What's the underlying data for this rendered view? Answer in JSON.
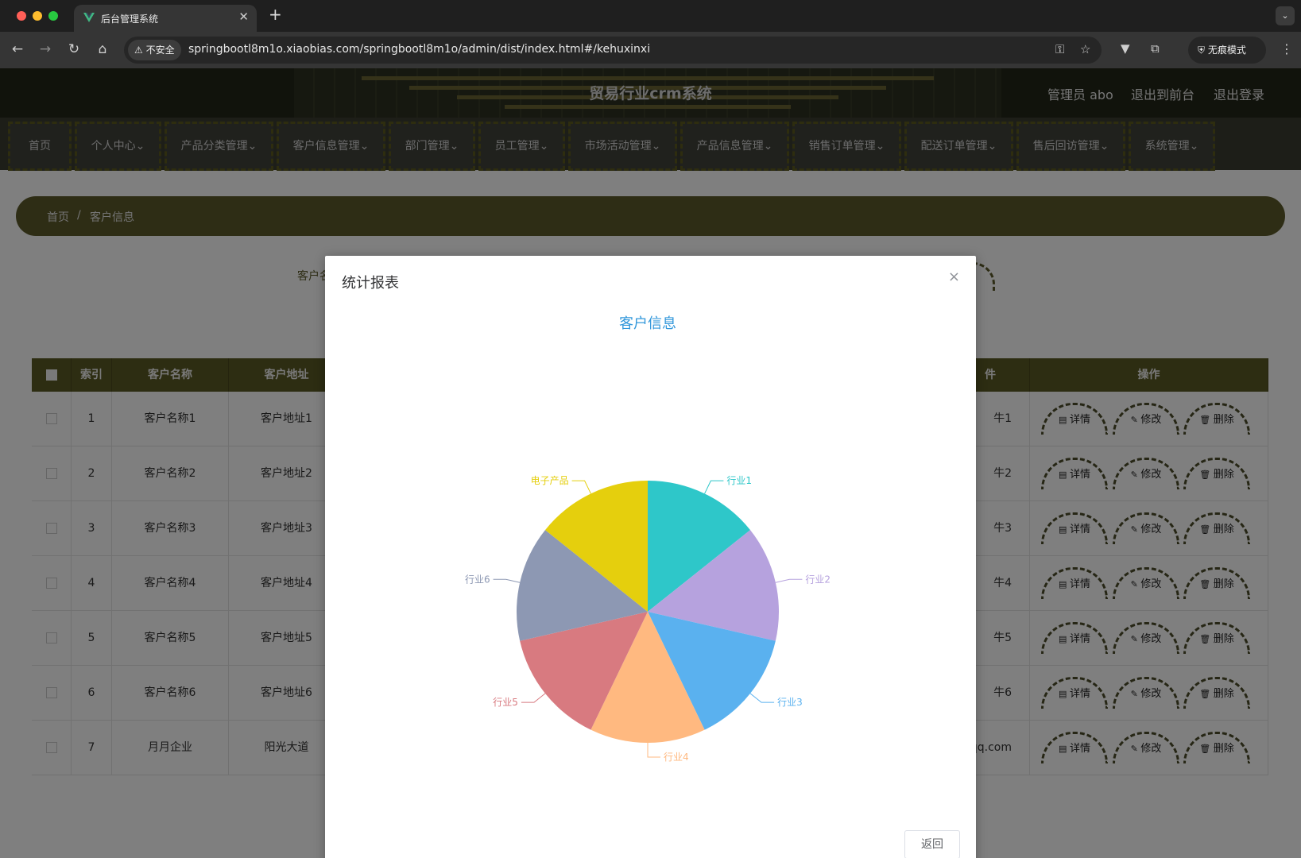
{
  "browser": {
    "tab_title": "后台管理系统",
    "tab_close": "✕",
    "new_tab": "+",
    "tab_menu": "⌄",
    "security_chip": "不安全",
    "url": "springbootl8m1o.xiaobias.com/springbootl8m1o/admin/dist/index.html#/kehuxinxi",
    "incognito_label": "无痕模式",
    "colors": {
      "tab_active": "#353535",
      "titlebar": "#1f1f1f"
    }
  },
  "header": {
    "system_title": "贸易行业crm系统",
    "user_label": "管理员 abo",
    "to_front_label": "退出到前台",
    "logout_label": "退出登录"
  },
  "nav": {
    "items": [
      {
        "label": "首页"
      },
      {
        "label": "个人中心⌄"
      },
      {
        "label": "产品分类管理⌄"
      },
      {
        "label": "客户信息管理⌄"
      },
      {
        "label": "部门管理⌄"
      },
      {
        "label": "员工管理⌄"
      },
      {
        "label": "市场活动管理⌄"
      },
      {
        "label": "产品信息管理⌄"
      },
      {
        "label": "销售订单管理⌄"
      },
      {
        "label": "配送订单管理⌄"
      },
      {
        "label": "售后回访管理⌄"
      },
      {
        "label": "系统管理⌄"
      }
    ]
  },
  "breadcrumb": {
    "home": "首页",
    "separator": "/",
    "current": "客户信息"
  },
  "search": {
    "label_partial": "客户名"
  },
  "table": {
    "headers": {
      "index": "索引",
      "name": "客户名称",
      "address": "客户地址",
      "partial": "件",
      "actions": "操作"
    },
    "rows": [
      {
        "index": "1",
        "name": "客户名称1",
        "address": "客户地址1",
        "partial": "牛1"
      },
      {
        "index": "2",
        "name": "客户名称2",
        "address": "客户地址2",
        "partial": "牛2"
      },
      {
        "index": "3",
        "name": "客户名称3",
        "address": "客户地址3",
        "partial": "牛3"
      },
      {
        "index": "4",
        "name": "客户名称4",
        "address": "客户地址4",
        "partial": "牛4"
      },
      {
        "index": "5",
        "name": "客户名称5",
        "address": "客户地址5",
        "partial": "牛5"
      },
      {
        "index": "6",
        "name": "客户名称6",
        "address": "客户地址6",
        "partial": "牛6"
      },
      {
        "index": "7",
        "name": "月月企业",
        "address": "阳光大道",
        "partial": "qq.com"
      }
    ],
    "actions": {
      "detail": "详情",
      "edit": "修改",
      "delete": "删除"
    }
  },
  "dialog": {
    "title": "统计报表",
    "close": "×",
    "return_button": "返回"
  },
  "chart_data": {
    "type": "pie",
    "title": "客户信息",
    "title_color": "#3398DB",
    "slices": [
      {
        "name": "行业1",
        "value": 1,
        "color": "#2EC7C9"
      },
      {
        "name": "行业2",
        "value": 1,
        "color": "#B6A2DE"
      },
      {
        "name": "行业3",
        "value": 1,
        "color": "#5AB1EF"
      },
      {
        "name": "行业4",
        "value": 1,
        "color": "#FFB980"
      },
      {
        "name": "行业5",
        "value": 1,
        "color": "#D87A80"
      },
      {
        "name": "行业6",
        "value": 1,
        "color": "#8D98B3"
      },
      {
        "name": "电子产品",
        "value": 1,
        "color": "#E5CF0D"
      }
    ]
  }
}
